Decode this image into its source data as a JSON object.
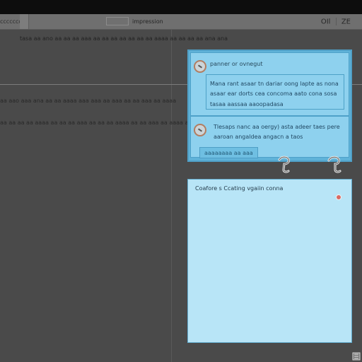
{
  "toolbar": {
    "left_label": "cccccccc",
    "title": "impression",
    "right_label": "OIl",
    "right_label_2": "ZE",
    "tab": {
      "name": "tab-main"
    }
  },
  "content": {
    "subtitle": "tasa aa ano aa aa aa aaa aa aa aa aa aa aa aa aaaa aa aa aa aa ana ana",
    "row_1": "aa aao aaa ana aa aa aaaa aaa aaa aa aaa aa aa aaa aa aaaa",
    "row_2": "aa aa aa aa aaaa aa aa aa aaa aa aa aa aaaa aa aa aaa aa aaaa aa aa aa aaa aa aa aaaa aa aa aaaa aa aaa aa aaa aa aaaa"
  },
  "chat_panel": {
    "header_title": "panner or ovnegut",
    "message": "Mana rant asaar tn dariar oong lapte as nona asaar ear dorts cea concoma aato cona sosa tasaa aassaa aaoopadasa",
    "reply": "Tlesaps nanc aa oergy) asta adeer taes pere aaroan angaldea angacn a taos",
    "button_label": "aaaaaaaa aa aaa"
  },
  "bottom_panel": {
    "title": "Coafore s Ccating vgaiin conna"
  },
  "colors": {
    "screen_background": "#4a4a4a",
    "panel_blue": "#5fb2d8",
    "panel_light_blue": "#8ed1ee",
    "bottom_panel_blue": "#b8e5f7",
    "status_red": "#d86a64"
  },
  "icons": {
    "avatar": "avatar-icon",
    "hook": "hook-icon",
    "dot": "status-dot-icon",
    "corner": "corner-icon"
  }
}
